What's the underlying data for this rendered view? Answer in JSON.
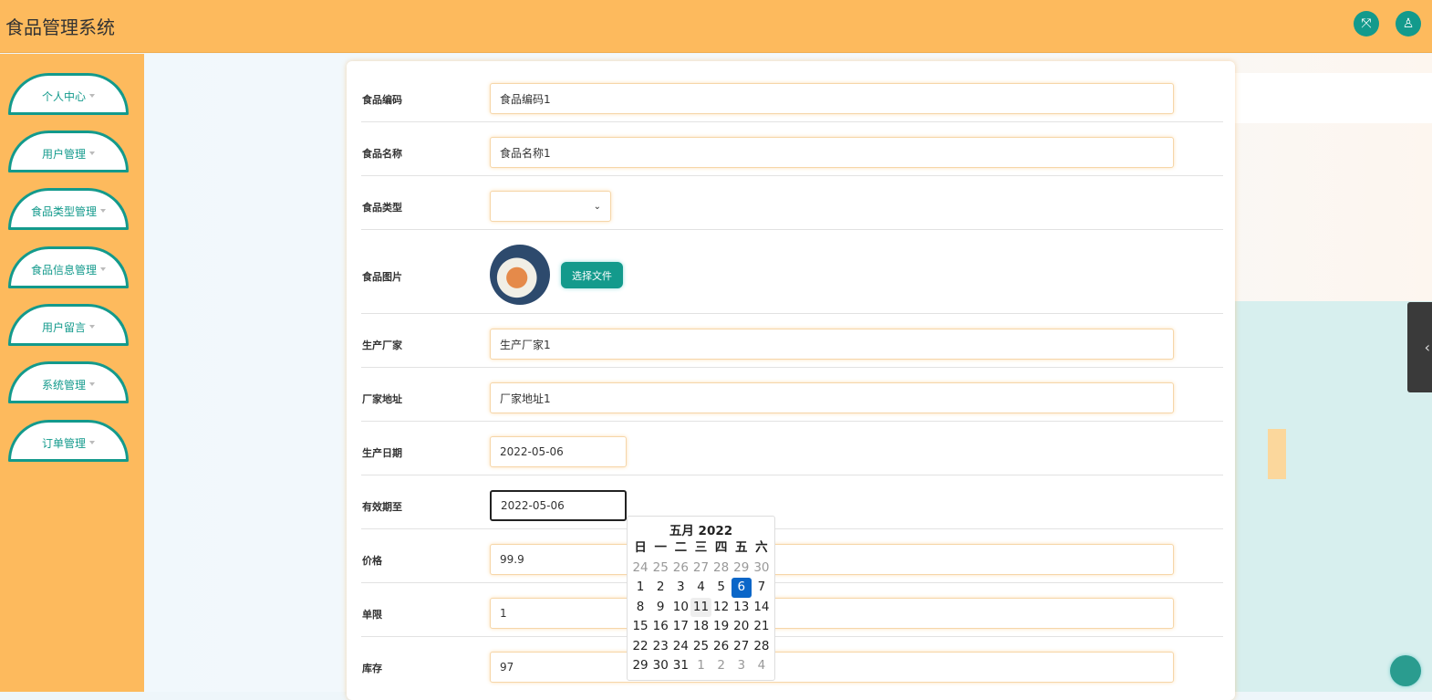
{
  "header": {
    "title": "食品管理系统",
    "fullscreen_icon": "expand-icon",
    "user_icon": "user-icon"
  },
  "sidebar": {
    "items": [
      {
        "label": "个人中心"
      },
      {
        "label": "用户管理"
      },
      {
        "label": "食品类型管理"
      },
      {
        "label": "食品信息管理"
      },
      {
        "label": "用户留言"
      },
      {
        "label": "系统管理"
      },
      {
        "label": "订单管理"
      }
    ]
  },
  "form": {
    "code": {
      "label": "食品编码",
      "value": "食品编码1"
    },
    "name": {
      "label": "食品名称",
      "value": "食品名称1"
    },
    "type": {
      "label": "食品类型",
      "value": ""
    },
    "image": {
      "label": "食品图片",
      "button": "选择文件"
    },
    "maker": {
      "label": "生产厂家",
      "value": "生产厂家1"
    },
    "address": {
      "label": "厂家地址",
      "value": "厂家地址1"
    },
    "prod_date": {
      "label": "生产日期",
      "value": "2022-05-06"
    },
    "expire": {
      "label": "有效期至",
      "value": "2022-05-06"
    },
    "price": {
      "label": "价格",
      "value": "99.9"
    },
    "limit": {
      "label": "单限",
      "value": "1"
    },
    "stock": {
      "label": "库存",
      "value": "97"
    }
  },
  "calendar": {
    "title": "五月 2022",
    "weekdays": [
      "日",
      "一",
      "二",
      "三",
      "四",
      "五",
      "六"
    ],
    "days": [
      "24",
      "25",
      "26",
      "27",
      "28",
      "29",
      "30",
      "1",
      "2",
      "3",
      "4",
      "5",
      "6",
      "7",
      "8",
      "9",
      "10",
      "11",
      "12",
      "13",
      "14",
      "15",
      "16",
      "17",
      "18",
      "19",
      "20",
      "21",
      "22",
      "23",
      "24",
      "25",
      "26",
      "27",
      "28",
      "29",
      "30",
      "31",
      "1",
      "2",
      "3",
      "4"
    ],
    "selected": "6",
    "hovered": "11"
  }
}
